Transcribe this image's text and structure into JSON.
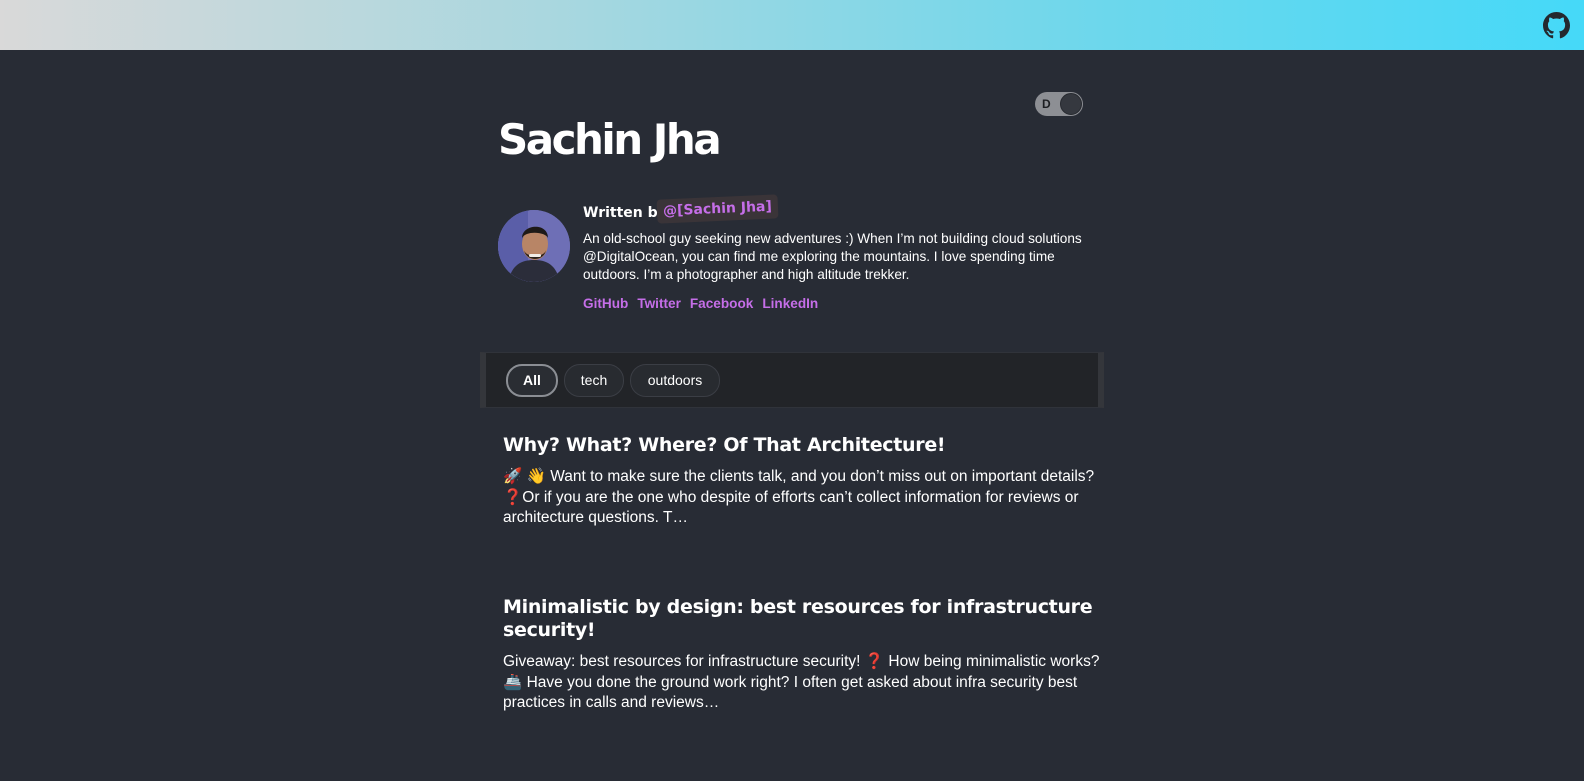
{
  "header": {
    "github_icon": "github-icon",
    "gradient_colors": [
      "#d9d9d9",
      "#a9d7df",
      "#6cd7ec",
      "#45d9f8"
    ]
  },
  "theme_toggle": {
    "label": "D",
    "state": "dark"
  },
  "site": {
    "title": "Sachin Jha"
  },
  "author": {
    "written_by_label": "Written by",
    "handle": "@[Sachin Jha]",
    "bio": "An old-school guy seeking new adventures :) When I’m not building cloud solutions @DigitalOcean, you can find me exploring the mountains. I love spending time outdoors. I’m a photographer and high altitude trekker.",
    "links": [
      {
        "label": "GitHub"
      },
      {
        "label": "Twitter"
      },
      {
        "label": "Facebook"
      },
      {
        "label": "LinkedIn"
      }
    ],
    "link_color": "#c56ee8"
  },
  "filters": {
    "items": [
      {
        "label": "All",
        "active": true
      },
      {
        "label": "tech",
        "active": false
      },
      {
        "label": "outdoors",
        "active": false
      }
    ]
  },
  "posts": [
    {
      "title": "Why? What? Where? Of That Architecture!",
      "excerpt": "🚀 👋 Want to make sure the clients talk, and you don’t miss out on important details? ❓Or if you are the one who despite of efforts can’t collect information for reviews or architecture questions. T…"
    },
    {
      "title": "Minimalistic by design: best resources for infrastructure security!",
      "excerpt": "Giveaway: best resources for infrastructure security! ❓ How being minimalistic works? 🚢 Have you done the ground work right? I often get asked about infra security best practices in calls and reviews…"
    }
  ],
  "colors": {
    "background": "#282c35",
    "accent": "#c56ee8"
  }
}
